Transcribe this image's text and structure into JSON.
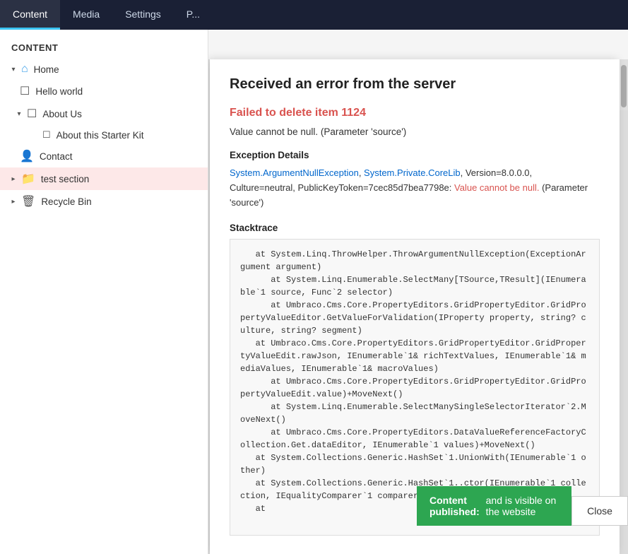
{
  "topNav": {
    "items": [
      {
        "label": "Content",
        "active": true
      },
      {
        "label": "Media",
        "active": false
      },
      {
        "label": "Settings",
        "active": false
      },
      {
        "label": "P...",
        "active": false
      }
    ]
  },
  "sidebar": {
    "title": "Content",
    "tree": [
      {
        "id": "home",
        "label": "Home",
        "icon": "home",
        "level": 0,
        "expanded": true,
        "hasExpander": true,
        "active": false
      },
      {
        "id": "hello-world",
        "label": "Hello world",
        "icon": "doc",
        "level": 1,
        "active": false
      },
      {
        "id": "about-us",
        "label": "About Us",
        "icon": "doc",
        "level": 1,
        "expanded": true,
        "hasExpander": true,
        "active": false
      },
      {
        "id": "about-starter-kit",
        "label": "About this Starter Kit",
        "icon": "doc",
        "level": 2,
        "active": false
      },
      {
        "id": "contact",
        "label": "Contact",
        "icon": "contact",
        "level": 1,
        "active": false
      },
      {
        "id": "test-section",
        "label": "test section",
        "icon": "folder",
        "level": 0,
        "active": true,
        "hasExpander": true
      },
      {
        "id": "recycle-bin",
        "label": "Recycle Bin",
        "icon": "trash",
        "level": 0,
        "active": false,
        "hasExpander": true
      }
    ]
  },
  "modal": {
    "title": "Received an error from the server",
    "errorTitle": "Failed to delete item 1124",
    "errorDescription": "Value cannot be null. (Parameter 'source')",
    "exceptionLabel": "Exception Details",
    "exceptionText": "System.ArgumentNullException, System.Private.CoreLib, Version=8.0.0.0, Culture=neutral, PublicKeyToken=7cec85d7bea7798e: Value cannot be null. (Parameter 'source')",
    "stacktraceLabel": "Stacktrace",
    "stacktraceText": "   at System.Linq.ThrowHelper.ThrowArgumentNullException(ExceptionArgument argument)\n      at System.Linq.Enumerable.SelectMany[TSource,TResult](IEnumerable`1 source, Func`2 selector)\n      at Umbraco.Cms.Core.PropertyEditors.GridPropertyEditor.GridPropertyValueEditor.GetValueForValidation(IProperty property, string? culture, string? segment)\n   at Umbraco.Cms.Core.PropertyEditors.GridPropertyEditor.GridPropertyValueEdit.rawJson, IEnumerable`1& richTextValues, IEnumerable`1& mediaValues, IEnumerable`1& macroValues)\n      at Umbraco.Cms.Core.PropertyEditors.GridPropertyEditor.GridPropertyValueEdit.value)+MoveNext()\n      at System.Linq.Enumerable.SelectManySingleSelectorIterator`2.MoveNext()\n      at Umbraco.Cms.Core.PropertyEditors.DataValueReferenceFactoryCollection.Get.dataEditor, IEnumerable`1 values)+MoveNext()\n   at System.Collections.Generic.HashSet`1.UnionWith(IEnumerable`1 other)\n   at System.Collections.Generic.HashSet`1..ctor(IEnumerable`1 collection, IEqualityComparer`1 comparer)\n   at",
    "closeLabel": "Close"
  },
  "toast": {
    "boldText": "Content published:",
    "text": "and is visible on the website"
  },
  "scrollbarVisible": true
}
